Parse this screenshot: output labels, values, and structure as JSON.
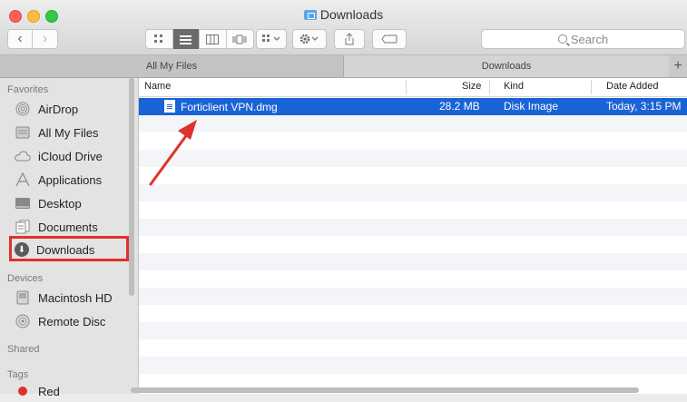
{
  "window": {
    "title": "Downloads"
  },
  "toolbar": {
    "back_glyph": "‹",
    "forward_glyph": "›",
    "search_placeholder": "Search"
  },
  "tabs": [
    {
      "label": "All My Files"
    },
    {
      "label": "Downloads"
    },
    {
      "label": "+"
    }
  ],
  "sidebar": {
    "favorites_header": "Favorites",
    "favorites": [
      {
        "label": "AirDrop",
        "icon": "airdrop-icon"
      },
      {
        "label": "All My Files",
        "icon": "all-files-icon"
      },
      {
        "label": "iCloud Drive",
        "icon": "cloud-icon"
      },
      {
        "label": "Applications",
        "icon": "applications-icon"
      },
      {
        "label": "Desktop",
        "icon": "desktop-icon"
      },
      {
        "label": "Documents",
        "icon": "documents-icon"
      },
      {
        "label": "Downloads",
        "icon": "download-icon"
      }
    ],
    "devices_header": "Devices",
    "devices": [
      {
        "label": "Macintosh HD",
        "icon": "hard-drive-icon"
      },
      {
        "label": "Remote Disc",
        "icon": "disc-icon"
      }
    ],
    "shared_header": "Shared",
    "tags_header": "Tags",
    "tags": [
      {
        "label": "Red",
        "color": "#e0312b"
      }
    ]
  },
  "columns": {
    "name": "Name",
    "size": "Size",
    "kind": "Kind",
    "date": "Date Added"
  },
  "files": [
    {
      "name": "Forticlient VPN.dmg",
      "size": "28.2 MB",
      "kind": "Disk Image",
      "date": "Today, 3:15 PM"
    }
  ],
  "colors": {
    "selection": "#1a63d6",
    "annotation": "#e0312b"
  }
}
